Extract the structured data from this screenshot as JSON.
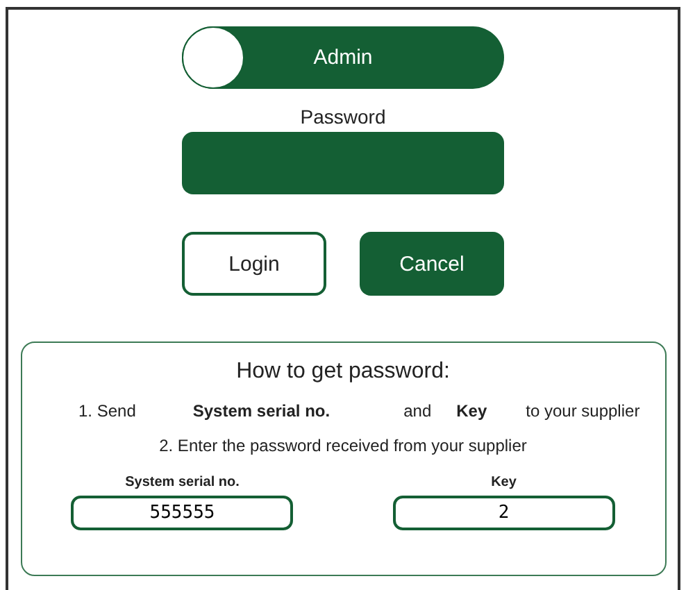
{
  "role_toggle": {
    "label": "Admin",
    "on": false
  },
  "password": {
    "label": "Password"
  },
  "buttons": [
    {
      "label": "Login",
      "kind": "outline"
    },
    {
      "label": "Cancel",
      "kind": "filled"
    }
  ],
  "help": {
    "title": "How to get password:",
    "step_1": [
      {
        "text": "1. Send",
        "kind": "plain"
      },
      {
        "text": "System serial no.",
        "kind": "bold"
      },
      {
        "text": "and",
        "kind": "plain"
      },
      {
        "text": "Key",
        "kind": "bold"
      },
      {
        "text": "to your supplier",
        "kind": "plain"
      }
    ],
    "step_2": "2. Enter the password received from your supplier",
    "fields": [
      {
        "label": "System serial no.",
        "value": "555555"
      },
      {
        "label": "Key",
        "value": "2"
      }
    ]
  }
}
